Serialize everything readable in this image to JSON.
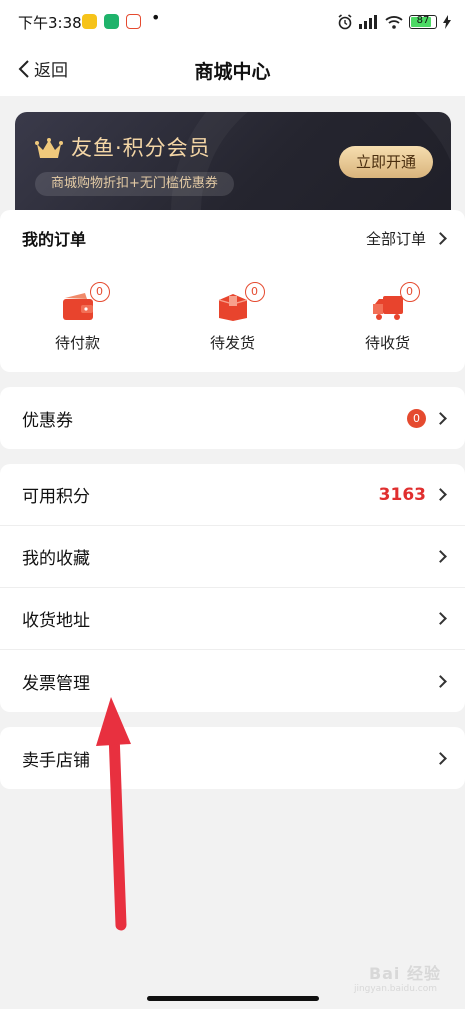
{
  "status_bar": {
    "time": "下午3:38",
    "battery": "87",
    "icons": [
      "meituan-icon",
      "vpn-icon",
      "app-icon",
      "alarm-icon",
      "signal-icon",
      "wifi-icon",
      "battery-icon",
      "charging-icon"
    ]
  },
  "nav": {
    "back_label": "返回",
    "title": "商城中心"
  },
  "banner": {
    "title": "友鱼·积分会员",
    "subtitle": "商城购物折扣+无门槛优惠券",
    "button": "立即开通"
  },
  "orders": {
    "title": "我的订单",
    "all_label": "全部订单",
    "items": [
      {
        "label": "待付款",
        "count": "0",
        "icon": "wallet-icon"
      },
      {
        "label": "待发货",
        "count": "0",
        "icon": "package-icon"
      },
      {
        "label": "待收货",
        "count": "0",
        "icon": "truck-icon"
      }
    ]
  },
  "coupons": {
    "label": "优惠券",
    "count": "0"
  },
  "menu": {
    "points_label": "可用积分",
    "points_value": "3163",
    "favorites": "我的收藏",
    "address": "收货地址",
    "invoice": "发票管理"
  },
  "seller": {
    "label": "卖手店铺"
  },
  "watermark": {
    "text": "Bai 经验",
    "url": "jingyan.baidu.com"
  },
  "colors": {
    "accent": "#e02f2f",
    "gold": "#f4d6a6",
    "banner_bg": "#25252f",
    "annotation_arrow": "#e8303f"
  }
}
